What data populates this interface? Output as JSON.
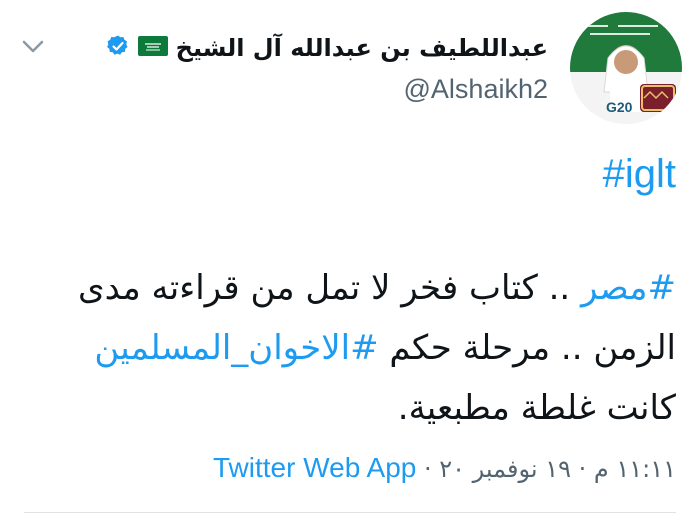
{
  "user": {
    "display_name": "عبداللطيف بن عبدالله آل الشيخ",
    "handle": "@Alshaikh2",
    "verified_badge_icon": "verified-badge-icon",
    "flag_icon": "saudi-flag-icon",
    "avatar_badge": "G20"
  },
  "tweet": {
    "hashtag_top": "#iglt",
    "line1_tag": "#مصر",
    "line1_text": " .. كتاب فخر لا تمل من قراءته مدى",
    "line2_text": "الزمن .. مرحلة حكم ",
    "line2_tag": "#الاخوان_المسلمين",
    "line3_text": "كانت غلطة مطبعية."
  },
  "meta": {
    "time_date": "١١:١١ م · ١٩ نوفمبر ٢٠ · ",
    "source": "Twitter Web App"
  },
  "icons": {
    "more": "chevron-down-icon"
  },
  "colors": {
    "link": "#1d9bf0",
    "text": "#0f1419",
    "muted": "#536471"
  }
}
